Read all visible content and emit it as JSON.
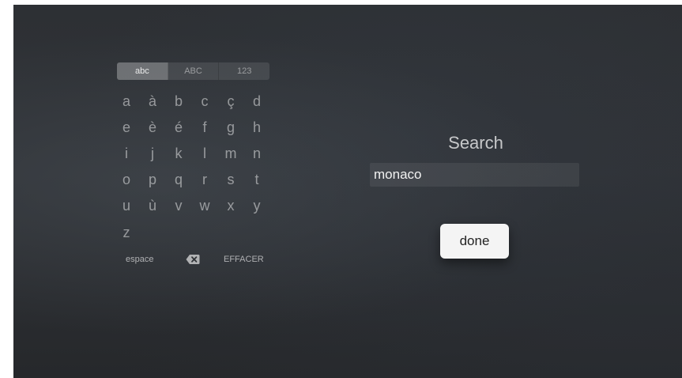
{
  "keyboard": {
    "tabs": [
      {
        "label": "abc",
        "active": true
      },
      {
        "label": "ABC",
        "active": false
      },
      {
        "label": "123",
        "active": false
      }
    ],
    "rows": [
      [
        "a",
        "à",
        "b",
        "c",
        "ç",
        "d"
      ],
      [
        "e",
        "è",
        "é",
        "f",
        "g",
        "h"
      ],
      [
        "i",
        "j",
        "k",
        "l",
        "m",
        "n"
      ],
      [
        "o",
        "p",
        "q",
        "r",
        "s",
        "t"
      ],
      [
        "u",
        "ù",
        "v",
        "w",
        "x",
        "y"
      ],
      [
        "z"
      ]
    ],
    "space_label": "espace",
    "delete_icon": "backspace-icon",
    "clear_label": "EFFACER"
  },
  "search": {
    "title": "Search",
    "query": "monaco"
  },
  "done_label": "done"
}
